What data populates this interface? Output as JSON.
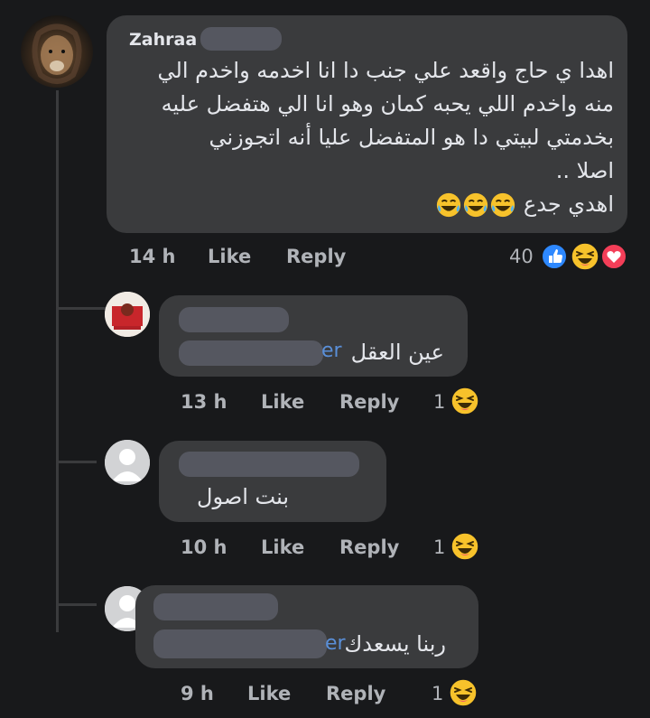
{
  "comments": [
    {
      "author": "Zahraa",
      "lines": [
        "اهدا ي حاج واقعد علي جنب دا انا اخدمه واخدم الي",
        "منه واخدم اللي يحبه كمان وهو انا الي هتفضل عليه",
        "بخدمتي لبيتي دا هو المتفضل عليا أنه اتجوزني",
        "اصلا ..",
        "اهدي جدع"
      ],
      "time": "14 h",
      "like": "Like",
      "reply": "Reply",
      "reaction_count": "40",
      "reactions": [
        "like-icon",
        "haha-icon",
        "love-icon"
      ]
    }
  ],
  "replies": [
    {
      "author_suffix": "er",
      "text": "عين العقل",
      "time": "13 h",
      "like": "Like",
      "reply": "Reply",
      "reaction_count": "1",
      "reaction": "haha-icon"
    },
    {
      "text": "بنت اصول",
      "time": "10 h",
      "like": "Like",
      "reply": "Reply",
      "reaction_count": "1",
      "reaction": "haha-icon"
    },
    {
      "author_suffix": "er",
      "text": "ربنا يسعدك",
      "time": "9 h",
      "like": "Like",
      "reply": "Reply",
      "reaction_count": "1",
      "reaction": "haha-icon"
    }
  ],
  "colors": {
    "background": "#18191b",
    "bubble": "#3a3b3d",
    "like_blue": "#2d88ff",
    "haha_yellow": "#f7c22b",
    "love_red": "#f33e58"
  }
}
